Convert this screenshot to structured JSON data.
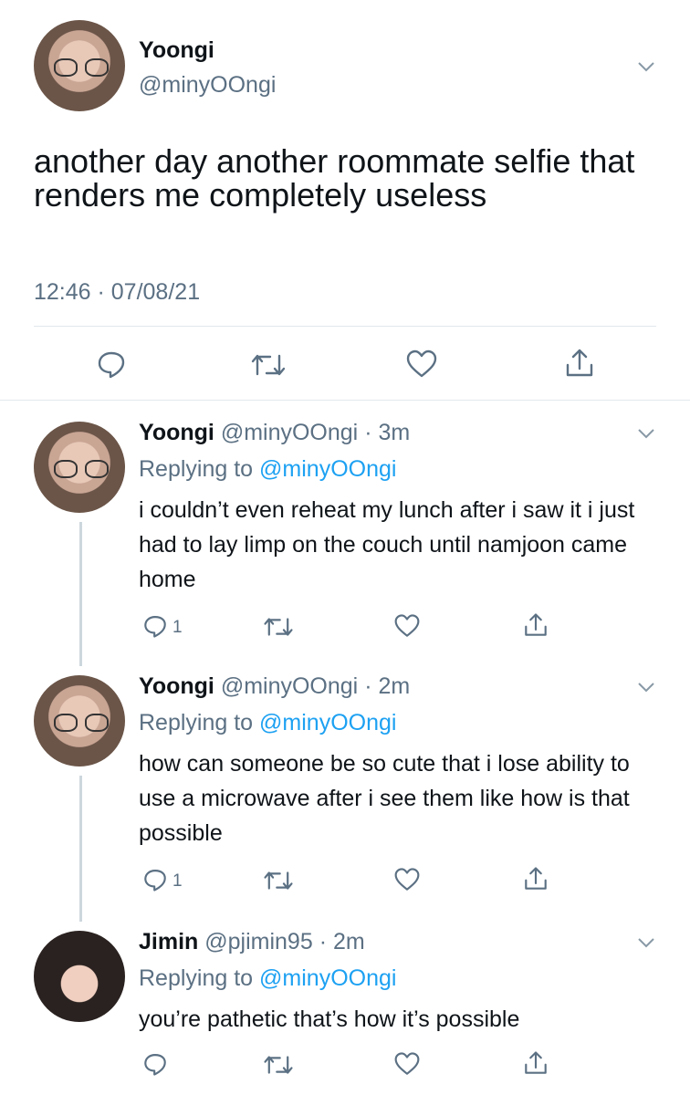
{
  "main_tweet": {
    "name": "Yoongi",
    "handle": "@minyOOngi",
    "text": "another day another roommate selfie that renders me completely useless",
    "timestamp": "12:46 · 07/08/21",
    "actions": [
      "reply-icon",
      "retweet-icon",
      "like-icon",
      "share-icon"
    ]
  },
  "replies": [
    {
      "name": "Yoongi",
      "handle": "@minyOOngi",
      "time": "· 3m",
      "replying_prefix": "Replying to",
      "replying_to": "@minyOOngi",
      "text": "i couldn’t even reheat my lunch after i saw it i just had to lay limp on the couch until namjoon came home",
      "reply_count": "1"
    },
    {
      "name": "Yoongi",
      "handle": "@minyOOngi",
      "time": "· 2m",
      "replying_prefix": "Replying to",
      "replying_to": "@minyOOngi",
      "text": "how can someone be so cute that i lose ability to use a microwave after i see them like how is that possible",
      "reply_count": "1"
    },
    {
      "name": "Jimin",
      "handle": "@pjimin95",
      "time": "· 2m",
      "replying_prefix": "Replying to",
      "replying_to": "@minyOOngi",
      "text": "you’re pathetic that’s how it’s possible",
      "reply_count": ""
    }
  ],
  "colors": {
    "accent": "#1da1f2",
    "secondary_text": "#5b7083",
    "divider": "#e1e8ed"
  }
}
